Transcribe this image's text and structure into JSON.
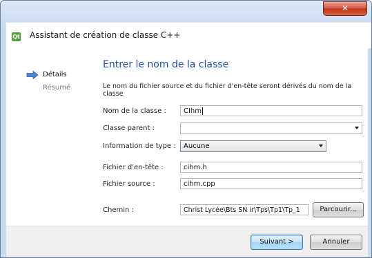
{
  "window": {
    "close_label": "✕",
    "app_icon_label": "Qt",
    "title": "Assistant de création de classe C++"
  },
  "sidebar": {
    "items": [
      {
        "label": "Détails",
        "active": true
      },
      {
        "label": "Résumé",
        "active": false
      }
    ]
  },
  "page": {
    "title": "Entrer le nom de la classe",
    "description": "Le nom du fichier source et du fichier d'en-tête seront dérivés du nom de la classe"
  },
  "form": {
    "class_name_label": "Nom de la classe :",
    "class_name_value": "CIhm",
    "parent_class_label": "Classe parent :",
    "parent_class_value": "",
    "type_info_label": "Information de type :",
    "type_info_value": "Aucune",
    "header_file_label": "Fichier d'en-tête :",
    "header_file_value": "cihm.h",
    "source_file_label": "Fichier source :",
    "source_file_value": "cihm.cpp",
    "path_label": "Chemin :",
    "path_value": "Christ Lycée\\Bts SN ir\\Tps\\Tp1\\Tp_1",
    "browse_label": "Parcourir..."
  },
  "footer": {
    "next_label": "Suivant >",
    "cancel_label": "Annuler"
  },
  "colors": {
    "accent": "#1f4ea5",
    "arrow": "#4a86d8"
  }
}
